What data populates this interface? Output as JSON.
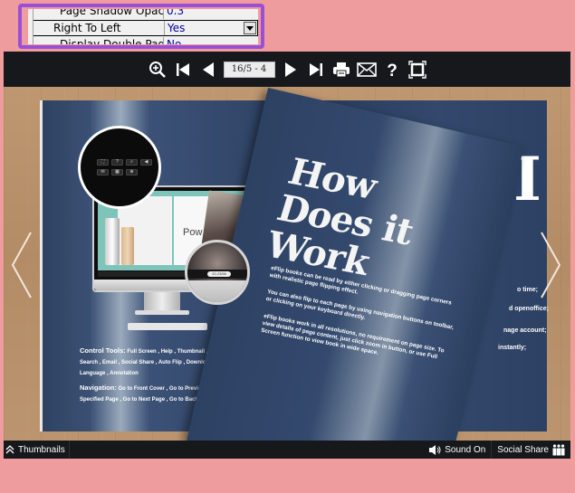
{
  "property_grid": {
    "rows": [
      {
        "name": "Page Shadow Opacity",
        "value": "0.3"
      },
      {
        "name": "Right To Left",
        "value": "Yes",
        "selected": true,
        "has_dropdown": true
      },
      {
        "name": "Display Double Pages",
        "value": "No"
      }
    ],
    "highlight_color": "#9b4fd6"
  },
  "toolbar": {
    "page_indicator": "16/5 - 4",
    "buttons": [
      "zoom-in",
      "first-page",
      "previous-page",
      "next-page",
      "last-page",
      "print",
      "email",
      "help",
      "fullscreen"
    ]
  },
  "bottom_bar": {
    "thumbnails_label": "Thumbnails",
    "sound_label": "Sound On",
    "social_share_label": "Social Share"
  },
  "book": {
    "flip_page_title": "How Does it Work",
    "flip_page_paragraphs": [
      "eFlip books can be read by either clicking or dragging page corners with realistic page flipping effect.",
      "You can also flip to each page by using navigation buttons on toolbar, or clicking on your keyboard directly.",
      "eFlip books work in all resolutions, no requirement on page size. To view details of page content, just click zoom in button, or use Full Screen function to view book in wide space."
    ],
    "left_page": {
      "control_tools_label": "Control Tools:",
      "control_tools_text": "Full Screen , Help , Thumbnail , Sound , Zoom In , Search , Email , Social Share , Auto Flip , Download , Single Page , Language , Annotation",
      "navigation_label": "Navigation:",
      "navigation_text": "Go to Front Cover , Go to Previous Page , Go to Any Specified Page , Go to Next Page , Go to Back Cover"
    },
    "illustration": {
      "screen_heading": "Pow",
      "mag_page_field": "22-23/56"
    },
    "right_page": {
      "heading_glyph": "I",
      "snippets": [
        "o time;",
        "d openoffice;",
        "nage account;",
        "instantly;"
      ]
    }
  },
  "colors": {
    "page_background": "#ef9c9e",
    "toolbar": "#16181b",
    "book_page": "#2f4262",
    "wood": "#b8926c"
  }
}
